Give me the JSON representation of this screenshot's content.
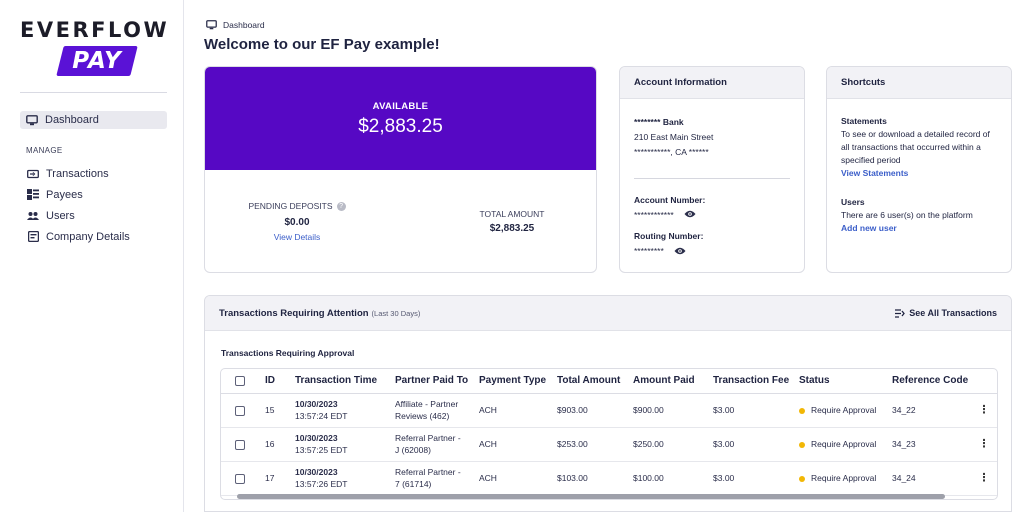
{
  "brand": {
    "logo_top": "EVERFLOW",
    "logo_bottom": "PAY",
    "accent": "#5608c4"
  },
  "sidebar": {
    "dashboard_label": "Dashboard",
    "manage_label": "MANAGE",
    "items": [
      {
        "label": "Transactions",
        "icon": "transactions-icon"
      },
      {
        "label": "Payees",
        "icon": "payees-icon"
      },
      {
        "label": "Users",
        "icon": "users-icon"
      },
      {
        "label": "Company Details",
        "icon": "company-icon"
      }
    ]
  },
  "header": {
    "breadcrumb": "Dashboard",
    "title": "Welcome to our EF Pay example!"
  },
  "balance": {
    "available_label": "AVAILABLE",
    "available_amount": "$2,883.25",
    "pending_label": "PENDING DEPOSITS",
    "pending_amount": "$0.00",
    "pending_link": "View Details",
    "total_label": "TOTAL AMOUNT",
    "total_amount": "$2,883.25"
  },
  "account": {
    "title": "Account Information",
    "bank": "******** Bank",
    "street": "210 East Main Street",
    "city": "***********, CA ******",
    "account_number_label": "Account Number:",
    "account_number": "************",
    "routing_number_label": "Routing Number:",
    "routing_number": "*********"
  },
  "shortcuts": {
    "title": "Shortcuts",
    "statements_title": "Statements",
    "statements_desc": "To see or download a detailed record of all transactions that occurred within a specified period",
    "statements_link": "View Statements",
    "users_title": "Users",
    "users_desc": "There are 6 user(s) on the platform",
    "users_link": "Add new user"
  },
  "transactions": {
    "title": "Transactions Requiring Attention",
    "subtitle": "(Last 30 Days)",
    "see_all": "See All Transactions",
    "approval_label": "Transactions Requiring Approval",
    "columns": [
      "ID",
      "Transaction Time",
      "Partner Paid To",
      "Payment Type",
      "Total Amount",
      "Amount Paid",
      "Transaction Fee",
      "Status",
      "Reference Code"
    ],
    "rows": [
      {
        "id": "15",
        "date": "10/30/2023",
        "time": "13:57:24 EDT",
        "partner_1": "Affiliate - Partner",
        "partner_2": "Reviews (462)",
        "type": "ACH",
        "total": "$903.00",
        "paid": "$900.00",
        "fee": "$3.00",
        "status": "Require Approval",
        "ref": "34_22"
      },
      {
        "id": "16",
        "date": "10/30/2023",
        "time": "13:57:25 EDT",
        "partner_1": "Referral Partner -",
        "partner_2": "J (62008)",
        "type": "ACH",
        "total": "$253.00",
        "paid": "$250.00",
        "fee": "$3.00",
        "status": "Require Approval",
        "ref": "34_23"
      },
      {
        "id": "17",
        "date": "10/30/2023",
        "time": "13:57:26 EDT",
        "partner_1": "Referral Partner -",
        "partner_2": "7 (61714)",
        "type": "ACH",
        "total": "$103.00",
        "paid": "$100.00",
        "fee": "$3.00",
        "status": "Require Approval",
        "ref": "34_24"
      }
    ],
    "status_color": "#f2b705"
  }
}
